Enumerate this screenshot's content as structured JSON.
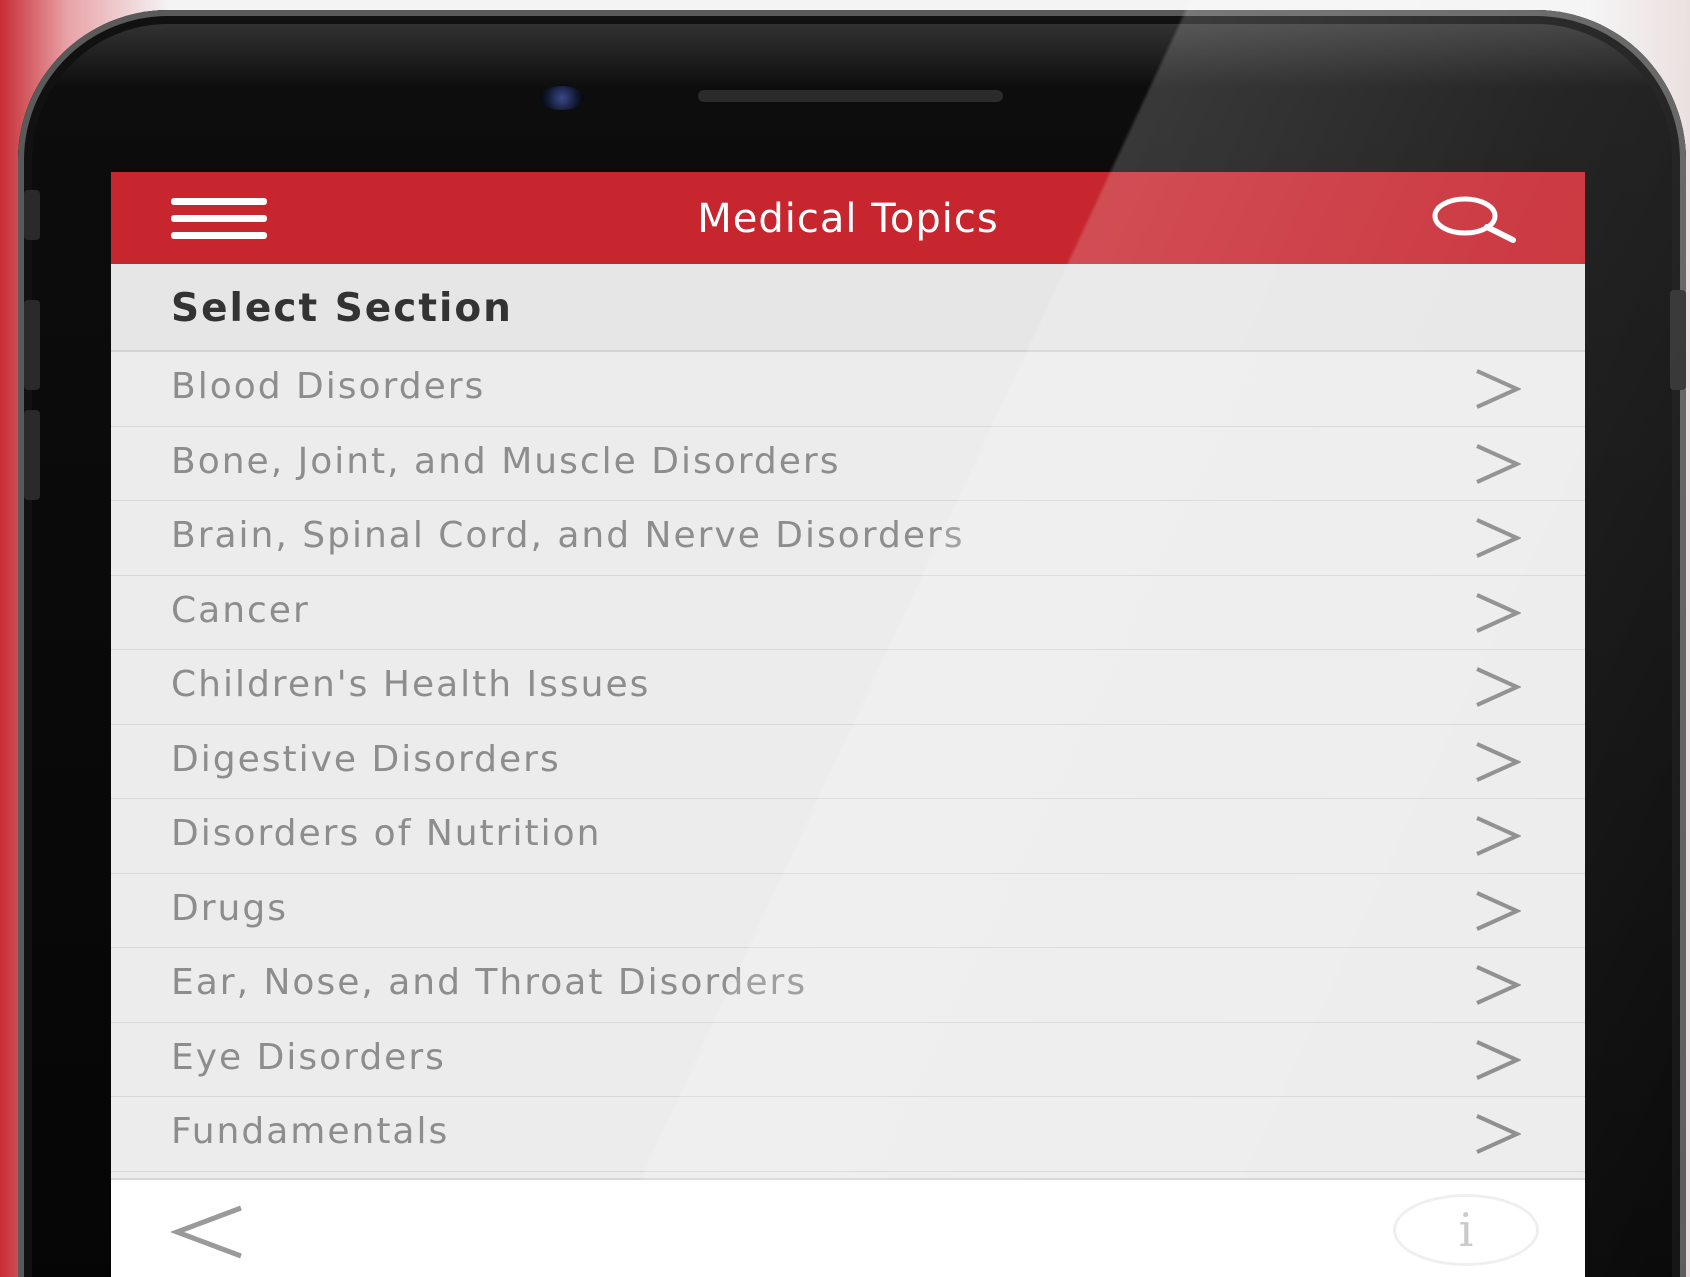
{
  "header": {
    "title": "Medical Topics",
    "menu_icon": "hamburger-menu-icon",
    "search_icon": "search-icon"
  },
  "section": {
    "title": "Select Section"
  },
  "topics": [
    {
      "label": "Blood Disorders"
    },
    {
      "label": "Bone, Joint, and Muscle Disorders"
    },
    {
      "label": "Brain, Spinal Cord, and Nerve Disorders"
    },
    {
      "label": "Cancer"
    },
    {
      "label": "Children's Health Issues"
    },
    {
      "label": "Digestive Disorders"
    },
    {
      "label": "Disorders of Nutrition"
    },
    {
      "label": "Drugs"
    },
    {
      "label": "Ear, Nose, and Throat Disorders"
    },
    {
      "label": "Eye Disorders"
    },
    {
      "label": "Fundamentals"
    }
  ],
  "toolbar": {
    "back_icon": "back-arrow-icon",
    "info_label": "i"
  },
  "colors": {
    "accent": "#c7262f",
    "list_background": "#ececec",
    "row_text": "#8d8d8d",
    "section_text": "#333333"
  }
}
